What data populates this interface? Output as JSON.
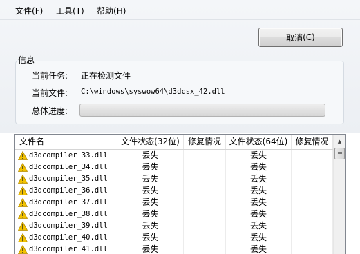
{
  "menu": [
    {
      "label": "文件",
      "mnemonic": "(F)"
    },
    {
      "label": "工具",
      "mnemonic": "(T)"
    },
    {
      "label": "帮助",
      "mnemonic": "(H)"
    }
  ],
  "cancel_button": {
    "label": "取消",
    "mnemonic": "(C)"
  },
  "info": {
    "title": "信息",
    "task_label": "当前任务:",
    "task_value": "正在检测文件",
    "file_label": "当前文件:",
    "file_value": "C:\\windows\\syswow64\\d3dcsx_42.dll",
    "progress_label": "总体进度:",
    "progress_value": 0.0
  },
  "table": {
    "columns": [
      "文件名",
      "文件状态(32位)",
      "修复情况",
      "文件状态(64位)",
      "修复情况"
    ],
    "rows": [
      {
        "name": "d3dcompiler_33.dll",
        "status32": "丢失",
        "repair32": "",
        "status64": "丢失",
        "repair64": ""
      },
      {
        "name": "d3dcompiler_34.dll",
        "status32": "丢失",
        "repair32": "",
        "status64": "丢失",
        "repair64": ""
      },
      {
        "name": "d3dcompiler_35.dll",
        "status32": "丢失",
        "repair32": "",
        "status64": "丢失",
        "repair64": ""
      },
      {
        "name": "d3dcompiler_36.dll",
        "status32": "丢失",
        "repair32": "",
        "status64": "丢失",
        "repair64": ""
      },
      {
        "name": "d3dcompiler_37.dll",
        "status32": "丢失",
        "repair32": "",
        "status64": "丢失",
        "repair64": ""
      },
      {
        "name": "d3dcompiler_38.dll",
        "status32": "丢失",
        "repair32": "",
        "status64": "丢失",
        "repair64": ""
      },
      {
        "name": "d3dcompiler_39.dll",
        "status32": "丢失",
        "repair32": "",
        "status64": "丢失",
        "repair64": ""
      },
      {
        "name": "d3dcompiler_40.dll",
        "status32": "丢失",
        "repair32": "",
        "status64": "丢失",
        "repair64": ""
      },
      {
        "name": "d3dcompiler_41.dll",
        "status32": "丢失",
        "repair32": "",
        "status64": "丢失",
        "repair64": ""
      }
    ]
  },
  "icons": {
    "row_icon": "warning-icon",
    "scroll_up": "chevron-up-icon"
  },
  "colors": {
    "warning": "#f2c200",
    "progress_fill": "#37b52a"
  }
}
